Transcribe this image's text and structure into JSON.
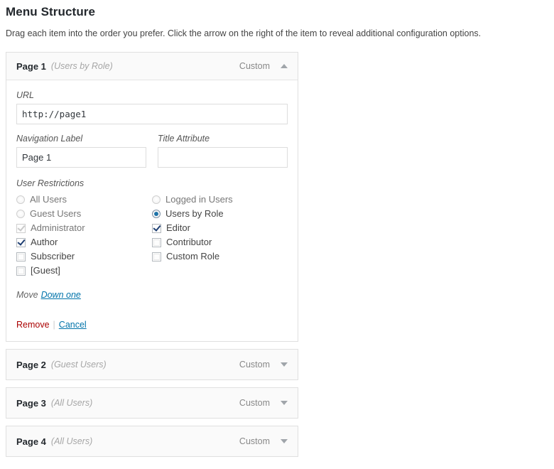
{
  "header": {
    "title": "Menu Structure",
    "description": "Drag each item into the order you prefer. Click the arrow on the right of the item to reveal additional configuration options."
  },
  "colors": {
    "link": "#0073aa",
    "remove": "#aa0000",
    "radio_selected": "#1e73a8",
    "panel_header_bg": "#fafafa",
    "border": "#e0e0e0"
  },
  "menu_items": [
    {
      "title": "Page 1",
      "subtitle": "(Users by Role)",
      "type_label": "Custom",
      "expanded": true,
      "toggle_icon": "chevron-up-icon",
      "fields": {
        "url_label": "URL",
        "url_value": "http://page1",
        "nav_label_label": "Navigation Label",
        "nav_label_value": "Page 1",
        "title_attr_label": "Title Attribute",
        "title_attr_value": ""
      },
      "restrictions": {
        "label": "User Restrictions",
        "left": [
          {
            "kind": "radio",
            "label": "All Users",
            "checked": false,
            "disabled": true
          },
          {
            "kind": "radio",
            "label": "Guest Users",
            "checked": false,
            "disabled": true
          },
          {
            "kind": "checkbox",
            "label": "Administrator",
            "checked": true,
            "disabled": true
          },
          {
            "kind": "checkbox",
            "label": "Author",
            "checked": true,
            "disabled": false
          },
          {
            "kind": "checkbox",
            "label": "Subscriber",
            "checked": false,
            "disabled": false
          },
          {
            "kind": "checkbox",
            "label": "[Guest]",
            "checked": false,
            "disabled": false
          }
        ],
        "right": [
          {
            "kind": "radio",
            "label": "Logged in Users",
            "checked": false,
            "disabled": true
          },
          {
            "kind": "radio",
            "label": "Users by Role",
            "checked": true,
            "disabled": false
          },
          {
            "kind": "checkbox",
            "label": "Editor",
            "checked": true,
            "disabled": false
          },
          {
            "kind": "checkbox",
            "label": "Contributor",
            "checked": false,
            "disabled": false
          },
          {
            "kind": "checkbox",
            "label": "Custom Role",
            "checked": false,
            "disabled": false
          }
        ]
      },
      "move": {
        "label": "Move",
        "links": [
          "Down one"
        ]
      },
      "actions": {
        "remove": "Remove",
        "separator": "|",
        "cancel": "Cancel"
      }
    },
    {
      "title": "Page 2",
      "subtitle": "(Guest Users)",
      "type_label": "Custom",
      "expanded": false,
      "toggle_icon": "chevron-down-icon"
    },
    {
      "title": "Page 3",
      "subtitle": "(All Users)",
      "type_label": "Custom",
      "expanded": false,
      "toggle_icon": "chevron-down-icon"
    },
    {
      "title": "Page 4",
      "subtitle": "(All Users)",
      "type_label": "Custom",
      "expanded": false,
      "toggle_icon": "chevron-down-icon"
    }
  ]
}
